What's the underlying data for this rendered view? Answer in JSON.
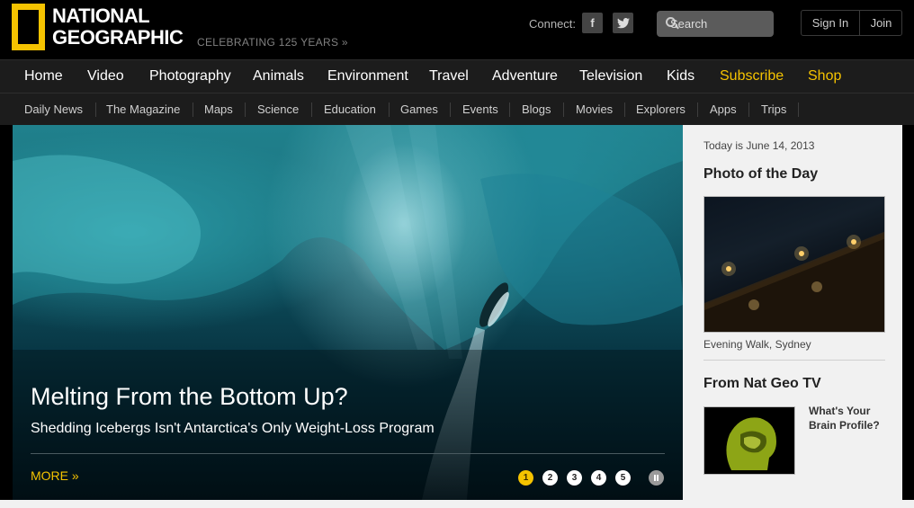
{
  "header": {
    "logo_line1": "NATIONAL",
    "logo_line2": "GEOGRAPHIC",
    "tagline": "CELEBRATING 125 YEARS »",
    "connect_label": "Connect:",
    "facebook_glyph": "f",
    "twitter_glyph": "t",
    "search_placeholder": "Search",
    "signin_label": "Sign In",
    "join_label": "Join"
  },
  "main_nav": {
    "items": [
      "Home",
      "Video",
      "Photography",
      "Animals",
      "Environment",
      "Travel",
      "Adventure",
      "Television",
      "Kids",
      "Subscribe",
      "Shop"
    ]
  },
  "sub_nav": {
    "items": [
      "Daily News",
      "The Magazine",
      "Maps",
      "Science",
      "Education",
      "Games",
      "Events",
      "Blogs",
      "Movies",
      "Explorers",
      "Apps",
      "Trips"
    ]
  },
  "hero": {
    "title": "Melting From the Bottom Up?",
    "subtitle": "Shedding Icebergs Isn't Antarctica's Only Weight-Loss Program",
    "more_label": "MORE »",
    "pages": [
      "1",
      "2",
      "3",
      "4",
      "5"
    ],
    "active_page": "1"
  },
  "sidebar": {
    "today": "Today is June 14, 2013",
    "photo_of_day_title": "Photo of the Day",
    "photo_caption": "Evening Walk, Sydney",
    "tv_title": "From Nat Geo TV",
    "tv_caption": "What's Your Brain Profile?"
  },
  "colors": {
    "brand_yellow": "#f5c300",
    "nav_bg": "#1c1c1c",
    "sidebar_bg": "#f1f1f1"
  },
  "icons": {
    "logo": "yellow-border-rectangle",
    "search": "search-icon",
    "pause": "pause-icon"
  }
}
